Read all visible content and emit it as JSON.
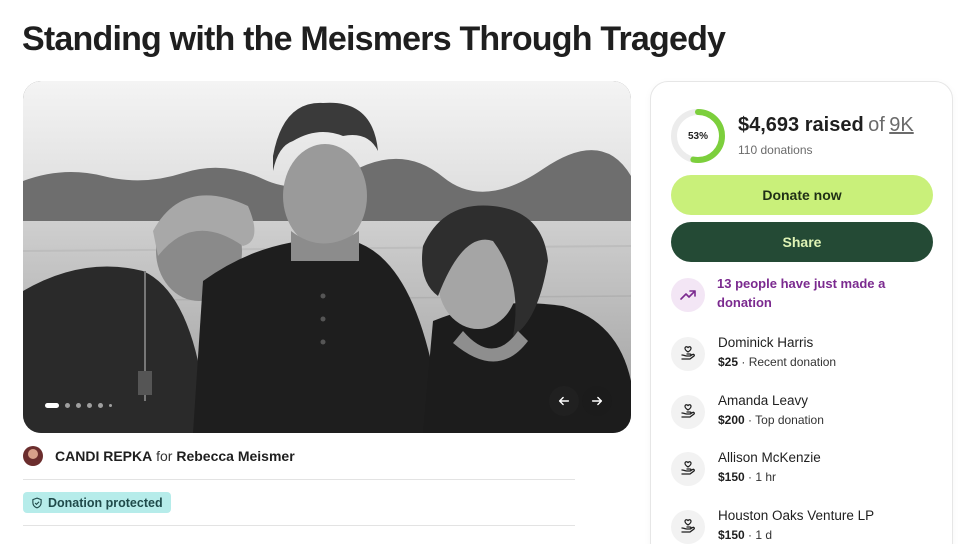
{
  "page": {
    "title": "Standing with the Meismers Through Tragedy"
  },
  "organizer": {
    "name": "CANDI REPKA",
    "for_word": "for",
    "beneficiary": "Rebecca Meismer"
  },
  "badge": {
    "label": "Donation protected",
    "icon": "shield-icon"
  },
  "carousel": {
    "slides": 6,
    "active_slide": 1
  },
  "progress": {
    "percent_label": "53%",
    "fraction": 0.53,
    "raised": "$4,693 raised",
    "of_word": "of",
    "goal": "9K",
    "donations_count": "110 donations"
  },
  "actions": {
    "donate_label": "Donate now",
    "share_label": "Share"
  },
  "activity": {
    "trend_text": "13 people have just made a donation",
    "icon": "trending-up-icon"
  },
  "donors": [
    {
      "name": "Dominick Harris",
      "amount": "$25",
      "detail": " · Recent donation"
    },
    {
      "name": "Amanda Leavy",
      "amount": "$200",
      "detail": " · Top donation"
    },
    {
      "name": "Allison McKenzie",
      "amount": "$150",
      "detail": " · 1 hr"
    },
    {
      "name": "Houston Oaks Venture LP",
      "amount": "$150",
      "detail": " · 1 d"
    }
  ],
  "colors": {
    "donate_button": "#c9f07a",
    "share_button": "#244a35",
    "progress_ring": "#7ccf3c",
    "badge_bg": "#b6ecea",
    "activity_text": "#7b2a8f"
  }
}
